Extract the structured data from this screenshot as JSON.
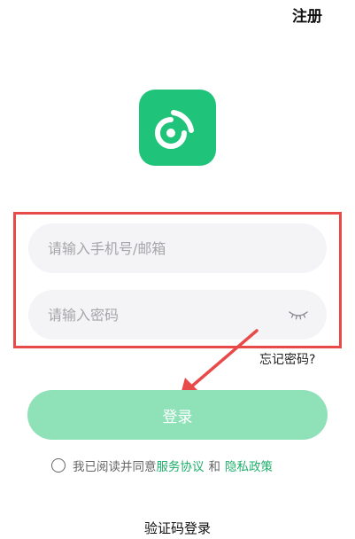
{
  "header": {
    "register_label": "注册"
  },
  "logo": {
    "icon": "broadcast-signal-icon",
    "bg_color": "#1fc37a"
  },
  "form": {
    "phone_placeholder": "请输入手机号/邮箱",
    "phone_value": "",
    "password_placeholder": "请输入密码",
    "password_value": "",
    "password_toggle_icon": "eye-closed-icon",
    "forgot_label": "忘记密码?"
  },
  "login_button": {
    "label": "登录",
    "color": "#8fe1b8"
  },
  "agreement": {
    "prefix": "我已阅读并同意",
    "terms_label": "服务协议",
    "and_label": "和",
    "privacy_label": "隐私政策",
    "link_color": "#1fae6c"
  },
  "footer": {
    "sms_login_label": "验证码登录"
  },
  "annotation": {
    "highlight_color": "#e84a4a"
  }
}
